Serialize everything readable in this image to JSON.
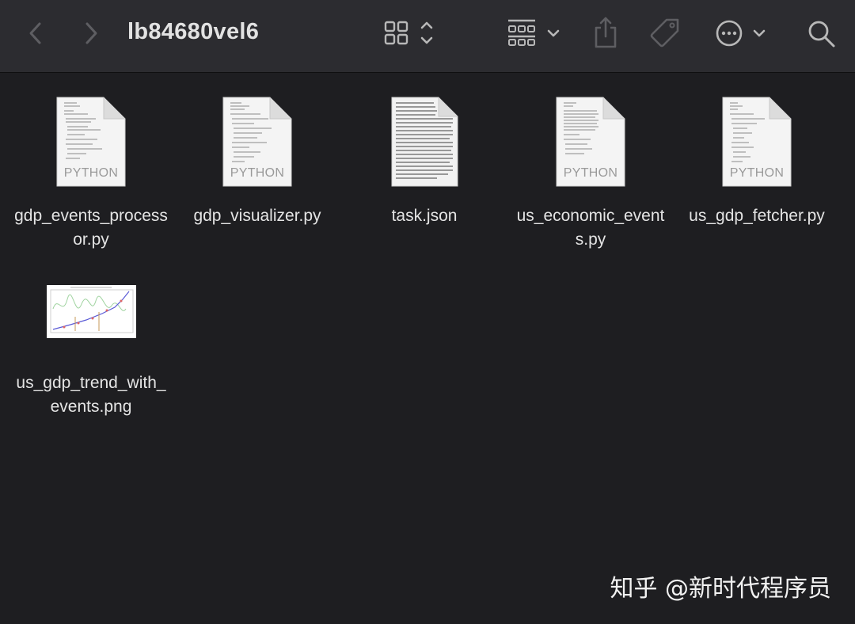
{
  "window": {
    "title": "lb84680vel6"
  },
  "toolbar": {
    "back_icon": "chevron-left-icon",
    "forward_icon": "chevron-right-icon",
    "view_icon": "grid-view-icon",
    "group_icon": "group-by-icon",
    "share_icon": "share-icon",
    "tag_icon": "tag-icon",
    "action_icon": "more-actions-icon",
    "search_icon": "search-icon"
  },
  "files": [
    {
      "name": "gdp_events_processor.py",
      "kind_label": "PYTHON",
      "type": "python"
    },
    {
      "name": "gdp_visualizer.py",
      "kind_label": "PYTHON",
      "type": "python"
    },
    {
      "name": "task.json",
      "kind_label": "",
      "type": "json"
    },
    {
      "name": "us_economic_events.py",
      "kind_label": "PYTHON",
      "type": "python"
    },
    {
      "name": "us_gdp_fetcher.py",
      "kind_label": "PYTHON",
      "type": "python"
    },
    {
      "name": "us_gdp_trend_with_events.png",
      "kind_label": "",
      "type": "image"
    }
  ],
  "watermark": "知乎 @新时代程序员",
  "colors": {
    "background": "#1e1e21",
    "toolbar": "#2c2c30",
    "text": "#e4e4e4"
  }
}
